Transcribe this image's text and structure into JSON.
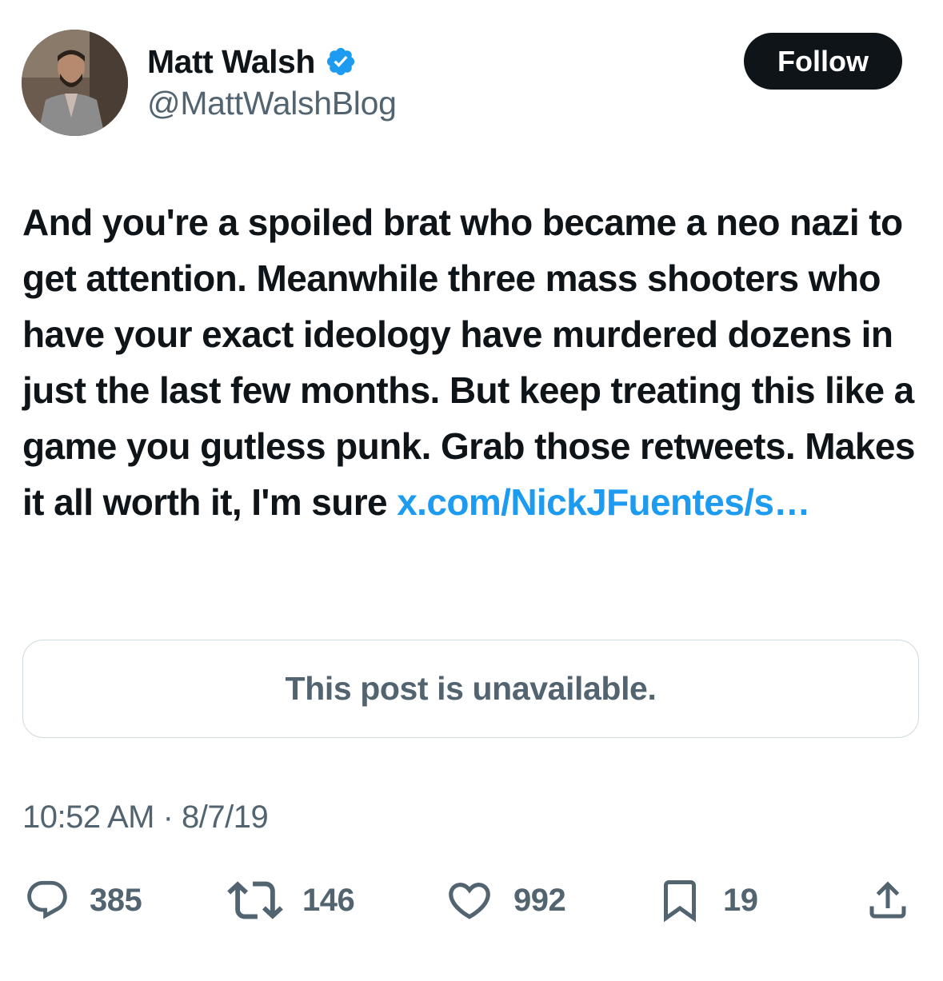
{
  "author": {
    "display_name": "Matt Walsh",
    "handle": "@MattWalshBlog",
    "verified": true
  },
  "follow_button_label": "Follow",
  "tweet": {
    "text": "And you're a spoiled brat who became a neo nazi to get attention. Meanwhile three mass shooters who have your exact ideology have murdered dozens in just the last few months. But keep treating this like a game you gutless punk. Grab those retweets. Makes it all worth it, I'm sure ",
    "link_text": "x.com/NickJFuentes/s…"
  },
  "quoted_post": {
    "message": "This post is unavailable."
  },
  "timestamp": "10:52 AM · 8/7/19",
  "actions": {
    "replies": "385",
    "reposts": "146",
    "likes": "992",
    "bookmarks": "19"
  },
  "icons": {
    "verified": "verified-badge-icon",
    "reply": "reply-icon",
    "repost": "repost-icon",
    "like": "heart-icon",
    "bookmark": "bookmark-icon",
    "share": "share-icon"
  },
  "colors": {
    "text_primary": "#0f1419",
    "text_secondary": "#536471",
    "link": "#1d9bf0",
    "verified": "#1d9bf0",
    "border": "#cfd9de",
    "follow_bg": "#0f1419"
  }
}
